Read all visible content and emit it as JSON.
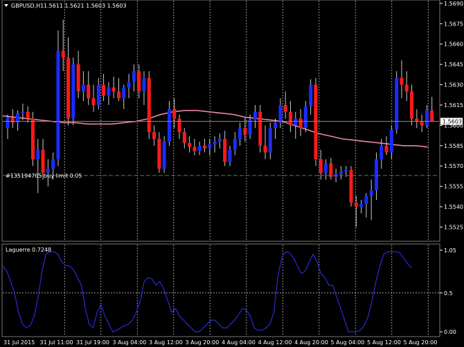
{
  "header": {
    "symbol": "GBPUSD,H1",
    "ohlc": "1.5611 1.5621 1.5603 1.5603"
  },
  "order_label": "#135194705 buy limit 0.05",
  "current_price_label": "1.5603",
  "indicator": {
    "title": "Laguerre 0.7248",
    "levels": [
      "1.05",
      "0.5",
      "0.00"
    ],
    "level_values": [
      1.05,
      0.5,
      0.0
    ],
    "values": [
      0.85,
      0.78,
      0.65,
      0.5,
      0.25,
      0.1,
      0.05,
      0.08,
      0.2,
      0.45,
      0.78,
      1.0,
      1.03,
      1.03,
      1.0,
      0.9,
      0.85,
      0.85,
      0.8,
      0.7,
      0.6,
      0.3,
      0.1,
      0.05,
      0.25,
      0.35,
      0.2,
      0.1,
      0.0,
      0.02,
      0.05,
      0.08,
      0.1,
      0.15,
      0.25,
      0.4,
      0.65,
      0.7,
      0.68,
      0.6,
      0.65,
      0.55,
      0.4,
      0.25,
      0.3,
      0.2,
      0.15,
      0.1,
      0.05,
      0.0,
      0.0,
      0.05,
      0.1,
      0.15,
      0.15,
      0.1,
      0.05,
      0.05,
      0.1,
      0.15,
      0.22,
      0.3,
      0.28,
      0.2,
      0.05,
      0.02,
      0.02,
      0.05,
      0.1,
      0.25,
      0.7,
      0.95,
      1.03,
      1.02,
      0.95,
      0.85,
      0.75,
      0.78,
      0.9,
      1.0,
      0.9,
      0.75,
      0.7,
      0.6,
      0.6,
      0.45,
      0.3,
      0.15,
      0.0,
      0.0,
      0.0,
      0.02,
      0.08,
      0.2,
      0.4,
      0.65,
      0.85,
      1.0,
      1.03,
      1.03,
      1.03,
      1.02,
      0.95,
      0.88,
      0.82
    ]
  },
  "chart_data": {
    "type": "candlestick",
    "symbol": "GBPUSD",
    "timeframe": "H1",
    "y_ticks": [
      1.5525,
      1.554,
      1.5555,
      1.557,
      1.5585,
      1.56,
      1.5615,
      1.563,
      1.5645,
      1.566,
      1.5675,
      1.569
    ],
    "y_tick_labels": [
      "1.5525",
      "1.5540",
      "1.5555",
      "1.5570",
      "1.5585",
      "1.5600",
      "1.5615",
      "1.5630",
      "1.5645",
      "1.5660",
      "1.5675",
      "1.5690"
    ],
    "ylim": [
      1.5515,
      1.5692
    ],
    "x_labels": [
      "31 Jul 2015",
      "31 Jul 11:00",
      "31 Jul 19:00",
      "3 Aug 04:00",
      "3 Aug 12:00",
      "3 Aug 20:00",
      "4 Aug 04:00",
      "4 Aug 12:00",
      "4 Aug 20:00",
      "5 Aug 04:00",
      "5 Aug 12:00",
      "5 Aug 20:00"
    ],
    "current_price": 1.5603,
    "buy_limit": 1.5563,
    "candles": [
      [
        1.5598,
        1.5608,
        1.559,
        1.5606
      ],
      [
        1.5606,
        1.5612,
        1.5598,
        1.5602
      ],
      [
        1.5602,
        1.5611,
        1.5596,
        1.5609
      ],
      [
        1.5609,
        1.5616,
        1.5604,
        1.561
      ],
      [
        1.561,
        1.5614,
        1.5602,
        1.5605
      ],
      [
        1.5605,
        1.561,
        1.557,
        1.5575
      ],
      [
        1.5575,
        1.559,
        1.555,
        1.5582
      ],
      [
        1.5582,
        1.559,
        1.556,
        1.5565
      ],
      [
        1.5565,
        1.5575,
        1.5555,
        1.5568
      ],
      [
        1.5568,
        1.558,
        1.556,
        1.5575
      ],
      [
        1.5575,
        1.567,
        1.557,
        1.5655
      ],
      [
        1.5655,
        1.5678,
        1.564,
        1.565
      ],
      [
        1.565,
        1.5665,
        1.56,
        1.5605
      ],
      [
        1.5605,
        1.565,
        1.56,
        1.5645
      ],
      [
        1.5645,
        1.5655,
        1.562,
        1.5625
      ],
      [
        1.5625,
        1.564,
        1.5618,
        1.563
      ],
      [
        1.563,
        1.564,
        1.5615,
        1.562
      ],
      [
        1.562,
        1.563,
        1.561,
        1.5615
      ],
      [
        1.5615,
        1.5635,
        1.5612,
        1.563
      ],
      [
        1.563,
        1.5638,
        1.5618,
        1.5622
      ],
      [
        1.5622,
        1.5632,
        1.5615,
        1.5628
      ],
      [
        1.5628,
        1.5636,
        1.562,
        1.5625
      ],
      [
        1.5625,
        1.5635,
        1.5618,
        1.562
      ],
      [
        1.562,
        1.563,
        1.5612,
        1.5628
      ],
      [
        1.5628,
        1.5638,
        1.562,
        1.5632
      ],
      [
        1.5632,
        1.5645,
        1.5625,
        1.564
      ],
      [
        1.564,
        1.5645,
        1.562,
        1.5625
      ],
      [
        1.5625,
        1.564,
        1.5615,
        1.5635
      ],
      [
        1.5635,
        1.564,
        1.559,
        1.5595
      ],
      [
        1.5595,
        1.56,
        1.5585,
        1.559
      ],
      [
        1.559,
        1.5595,
        1.5565,
        1.5568
      ],
      [
        1.5568,
        1.5592,
        1.5565,
        1.5588
      ],
      [
        1.5588,
        1.5618,
        1.5585,
        1.5612
      ],
      [
        1.5612,
        1.562,
        1.5598,
        1.5605
      ],
      [
        1.5605,
        1.5608,
        1.559,
        1.5595
      ],
      [
        1.5595,
        1.5598,
        1.5583,
        1.5587
      ],
      [
        1.5587,
        1.5592,
        1.558,
        1.5584
      ],
      [
        1.5584,
        1.559,
        1.5578,
        1.5581
      ],
      [
        1.5581,
        1.5588,
        1.5578,
        1.5585
      ],
      [
        1.5585,
        1.559,
        1.558,
        1.5583
      ],
      [
        1.5583,
        1.559,
        1.5578,
        1.5586
      ],
      [
        1.5586,
        1.5592,
        1.558,
        1.5588
      ],
      [
        1.5588,
        1.5594,
        1.5583,
        1.559
      ],
      [
        1.559,
        1.5596,
        1.557,
        1.5573
      ],
      [
        1.5573,
        1.5585,
        1.557,
        1.5582
      ],
      [
        1.5582,
        1.5595,
        1.5578,
        1.559
      ],
      [
        1.559,
        1.5602,
        1.5585,
        1.5598
      ],
      [
        1.5598,
        1.5606,
        1.5588,
        1.5593
      ],
      [
        1.5593,
        1.5608,
        1.559,
        1.5604
      ],
      [
        1.5604,
        1.5615,
        1.5598,
        1.561
      ],
      [
        1.561,
        1.5615,
        1.558,
        1.5585
      ],
      [
        1.5585,
        1.56,
        1.5575,
        1.558
      ],
      [
        1.558,
        1.5602,
        1.5575,
        1.5598
      ],
      [
        1.5598,
        1.5605,
        1.559,
        1.5602
      ],
      [
        1.5602,
        1.562,
        1.5598,
        1.5615
      ],
      [
        1.5615,
        1.5625,
        1.5605,
        1.561
      ],
      [
        1.561,
        1.5618,
        1.5595,
        1.56
      ],
      [
        1.56,
        1.561,
        1.559,
        1.5605
      ],
      [
        1.5605,
        1.5612,
        1.5592,
        1.5598
      ],
      [
        1.5598,
        1.5618,
        1.5595,
        1.5614
      ],
      [
        1.5614,
        1.5634,
        1.5608,
        1.563
      ],
      [
        1.563,
        1.5635,
        1.557,
        1.5575
      ],
      [
        1.5575,
        1.5582,
        1.556,
        1.5565
      ],
      [
        1.5565,
        1.5575,
        1.556,
        1.5572
      ],
      [
        1.5572,
        1.5576,
        1.556,
        1.5562
      ],
      [
        1.5562,
        1.5568,
        1.5558,
        1.5564
      ],
      [
        1.5564,
        1.557,
        1.556,
        1.5566
      ],
      [
        1.5566,
        1.557,
        1.5562,
        1.5567
      ],
      [
        1.5567,
        1.557,
        1.554,
        1.5543
      ],
      [
        1.5543,
        1.5548,
        1.5525,
        1.554
      ],
      [
        1.554,
        1.5545,
        1.5535,
        1.5542
      ],
      [
        1.5542,
        1.555,
        1.5532,
        1.5548
      ],
      [
        1.5548,
        1.556,
        1.553,
        1.5552
      ],
      [
        1.5552,
        1.558,
        1.5545,
        1.5575
      ],
      [
        1.5575,
        1.559,
        1.5568,
        1.5585
      ],
      [
        1.5585,
        1.5592,
        1.5578,
        1.558
      ],
      [
        1.558,
        1.56,
        1.5575,
        1.5597
      ],
      [
        1.5597,
        1.564,
        1.5594,
        1.5635
      ],
      [
        1.5635,
        1.5648,
        1.562,
        1.563
      ],
      [
        1.563,
        1.564,
        1.5618,
        1.5625
      ],
      [
        1.5625,
        1.563,
        1.56,
        1.5605
      ],
      [
        1.5605,
        1.5612,
        1.5598,
        1.5603
      ],
      [
        1.5603,
        1.5608,
        1.5595,
        1.56
      ],
      [
        1.56,
        1.5615,
        1.5598,
        1.5611
      ],
      [
        1.5611,
        1.5621,
        1.5603,
        1.5603
      ]
    ],
    "moving_average": [
      1.5607,
      1.5606,
      1.5605,
      1.5604,
      1.5603,
      1.5602,
      1.5602,
      1.5601,
      1.5601,
      1.5601,
      1.5602,
      1.5603,
      1.5605,
      1.5608,
      1.561,
      1.5611,
      1.5611,
      1.561,
      1.5609,
      1.5608,
      1.5606,
      1.5605,
      1.5604,
      1.5603,
      1.56,
      1.5597,
      1.5594,
      1.5592,
      1.559,
      1.5589,
      1.5588,
      1.5587,
      1.5586,
      1.5585,
      1.5585,
      1.5584
    ]
  }
}
